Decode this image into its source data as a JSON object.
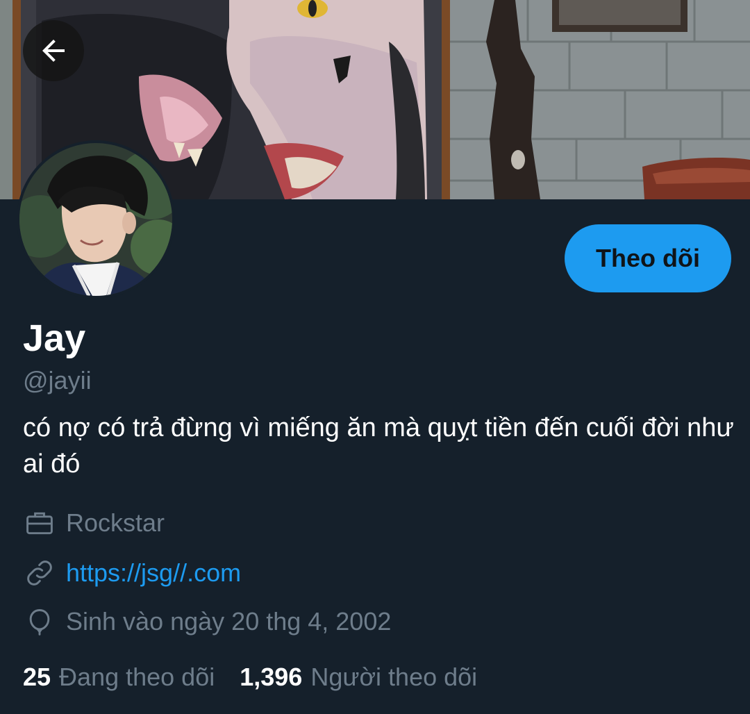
{
  "profile": {
    "display_name": "Jay",
    "handle": "@jayii",
    "bio": "có nợ có trả đừng vì miếng ăn mà quỵt tiền đến cuối đời như ai đó",
    "occupation": "Rockstar",
    "website": "https://jsg//.com",
    "birthday": "Sinh vào ngày 20 thg 4, 2002"
  },
  "actions": {
    "follow_label": "Theo dõi"
  },
  "stats": {
    "following_count": "25",
    "following_label": "Đang theo dõi",
    "followers_count": "1,396",
    "followers_label": "Người theo dõi"
  },
  "icons": {
    "back": "arrow-left-icon",
    "occupation": "briefcase-icon",
    "website": "link-icon",
    "birthday": "balloon-icon"
  },
  "colors": {
    "background": "#15202b",
    "accent": "#1d9bf0",
    "muted_text": "#6e7d8b",
    "text": "#ffffff"
  }
}
